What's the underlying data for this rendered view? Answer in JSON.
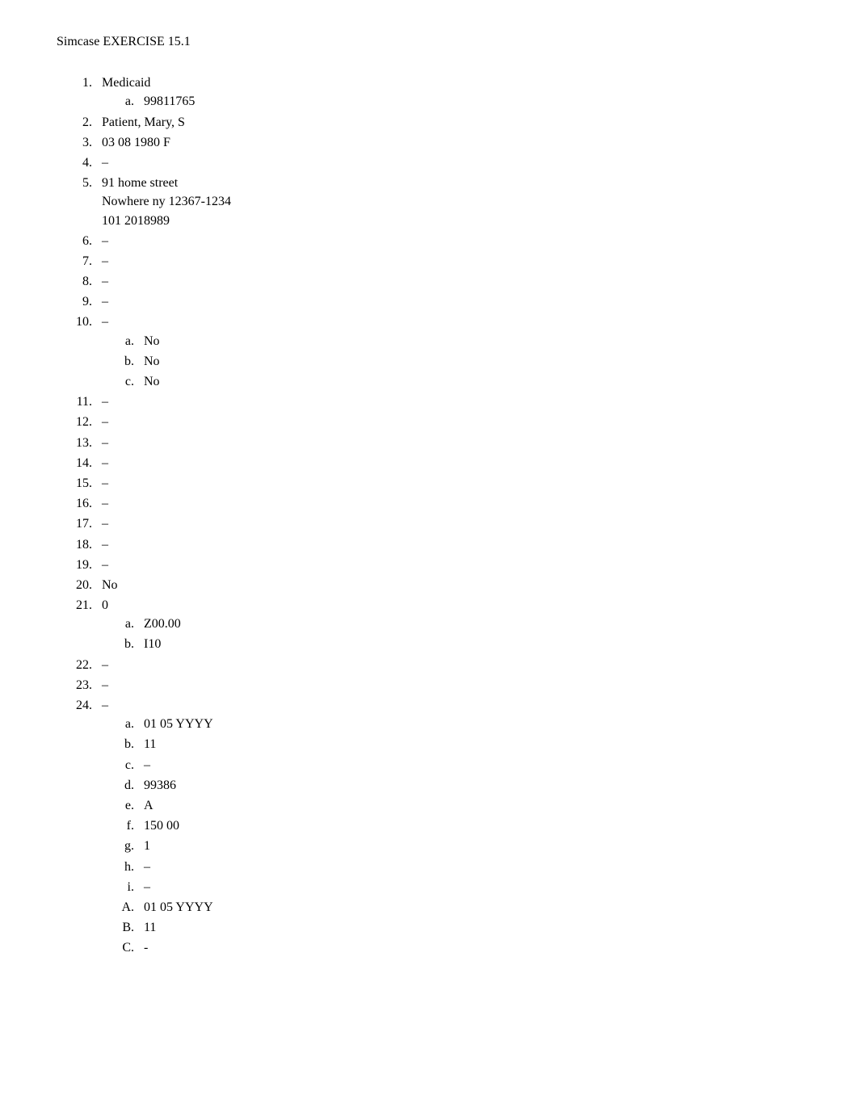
{
  "header": "Simcase EXERCISE 15.1",
  "items": {
    "i1": "Medicaid",
    "i1a": "99811765",
    "i2": "Patient, Mary, S",
    "i3": "03 08 1980 F",
    "i4": "–",
    "i5_line1": "91 home street",
    "i5_line2": "Nowhere ny 12367-1234",
    "i5_line3": "101 2018989",
    "i6": "–",
    "i7": "–",
    "i8": "–",
    "i9": "–",
    "i10": "–",
    "i10a": "No",
    "i10b": "No",
    "i10c": "No",
    "i11": "–",
    "i12": "–",
    "i13": "–",
    "i14": "–",
    "i15": "–",
    "i16": "–",
    "i17": "–",
    "i18": "–",
    "i19": "–",
    "i20": "No",
    "i21": "0",
    "i21a": "Z00.00",
    "i21b": "I10",
    "i22": "–",
    "i23": "–",
    "i24": "–",
    "i24a": "01 05 YYYY",
    "i24b": "11",
    "i24c": "–",
    "i24d": "99386",
    "i24e": "A",
    "i24f": "150 00",
    "i24g": "1",
    "i24h": "–",
    "i24i": "–",
    "i24A": "01 05 YYYY",
    "i24B": "11",
    "i24C": "-"
  }
}
